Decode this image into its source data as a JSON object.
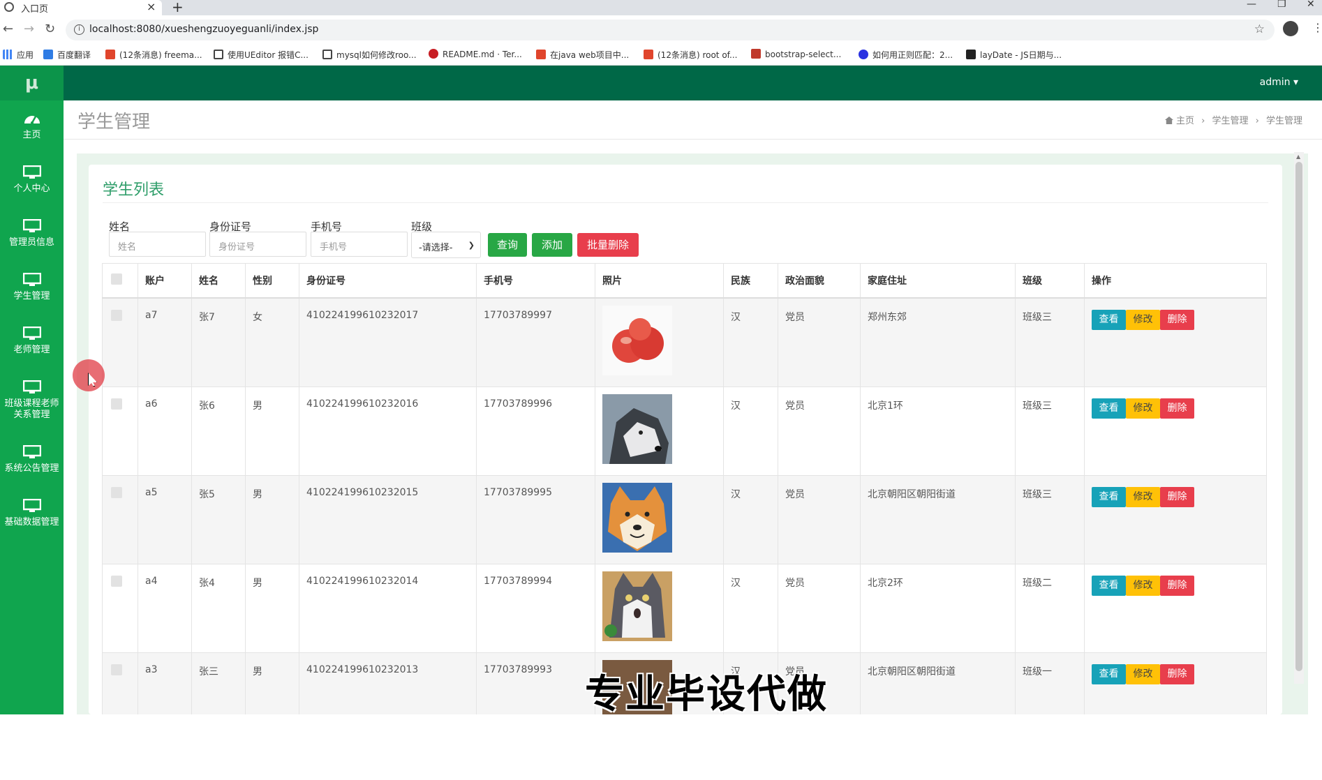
{
  "browser": {
    "tab_title": "入口页",
    "url": "localhost:8080/xueshengzuoyeguanli/index.jsp",
    "bookmarks": [
      "应用",
      "百度翻译",
      "(12条消息) freema...",
      "使用UEditor 报错C...",
      "mysql如何修改roo...",
      "README.md · Ter...",
      "在java web项目中...",
      "(12条消息) root of...",
      "bootstrap-select...",
      "如何用正则匹配：2...",
      "layDate - JS日期与..."
    ]
  },
  "app": {
    "logo": "μ",
    "user": "admin",
    "sidebar": [
      {
        "label": "主页",
        "icon": "dashboard-icon"
      },
      {
        "label": "个人中心",
        "icon": "monitor-icon"
      },
      {
        "label": "管理员信息",
        "icon": "monitor-icon"
      },
      {
        "label": "学生管理",
        "icon": "monitor-icon"
      },
      {
        "label": "老师管理",
        "icon": "monitor-icon"
      },
      {
        "label": "班级课程老师关系管理",
        "icon": "monitor-icon"
      },
      {
        "label": "系统公告管理",
        "icon": "monitor-icon"
      },
      {
        "label": "基础数据管理",
        "icon": "monitor-icon"
      }
    ],
    "page_title": "学生管理",
    "breadcrumb": [
      "主页",
      "学生管理",
      "学生管理"
    ]
  },
  "card": {
    "title": "学生列表",
    "filters": {
      "name_label": "姓名",
      "name_placeholder": "姓名",
      "id_label": "身份证号",
      "id_placeholder": "身份证号",
      "phone_label": "手机号",
      "phone_placeholder": "手机号",
      "class_label": "班级",
      "class_selected": "-请选择-"
    },
    "buttons": {
      "search": "查询",
      "add": "添加",
      "batch_delete": "批量删除"
    },
    "colors": {
      "search": "#28a745",
      "add": "#28a745",
      "batch_delete": "#e83e4c"
    }
  },
  "table": {
    "headers": [
      "账户",
      "姓名",
      "性别",
      "身份证号",
      "手机号",
      "照片",
      "民族",
      "政治面貌",
      "家庭住址",
      "班级",
      "操作"
    ],
    "ops": {
      "view": "查看",
      "edit": "修改",
      "delete": "删除"
    },
    "rows": [
      {
        "account": "a7",
        "name": "张7",
        "gender": "女",
        "id": "410224199610232017",
        "phone": "17703789997",
        "photo": "apples",
        "ethnic": "汉",
        "political": "党员",
        "address": "郑州东郊",
        "class": "班级三"
      },
      {
        "account": "a6",
        "name": "张6",
        "gender": "男",
        "id": "410224199610232016",
        "phone": "17703789996",
        "photo": "husky",
        "ethnic": "汉",
        "political": "党员",
        "address": "北京1环",
        "class": "班级三"
      },
      {
        "account": "a5",
        "name": "张5",
        "gender": "男",
        "id": "410224199610232015",
        "phone": "17703789995",
        "photo": "shiba",
        "ethnic": "汉",
        "political": "党员",
        "address": "北京朝阳区朝阳街道",
        "class": "班级三"
      },
      {
        "account": "a4",
        "name": "张4",
        "gender": "男",
        "id": "410224199610232014",
        "phone": "17703789994",
        "photo": "cat",
        "ethnic": "汉",
        "political": "党员",
        "address": "北京2环",
        "class": "班级二"
      },
      {
        "account": "a3",
        "name": "张三",
        "gender": "男",
        "id": "410224199610232013",
        "phone": "17703789993",
        "photo": "partial",
        "ethnic": "汉",
        "political": "党员",
        "address": "北京朝阳区朝阳街道",
        "class": "班级一"
      }
    ]
  },
  "overlay": {
    "watermark": "专业毕设代做"
  }
}
